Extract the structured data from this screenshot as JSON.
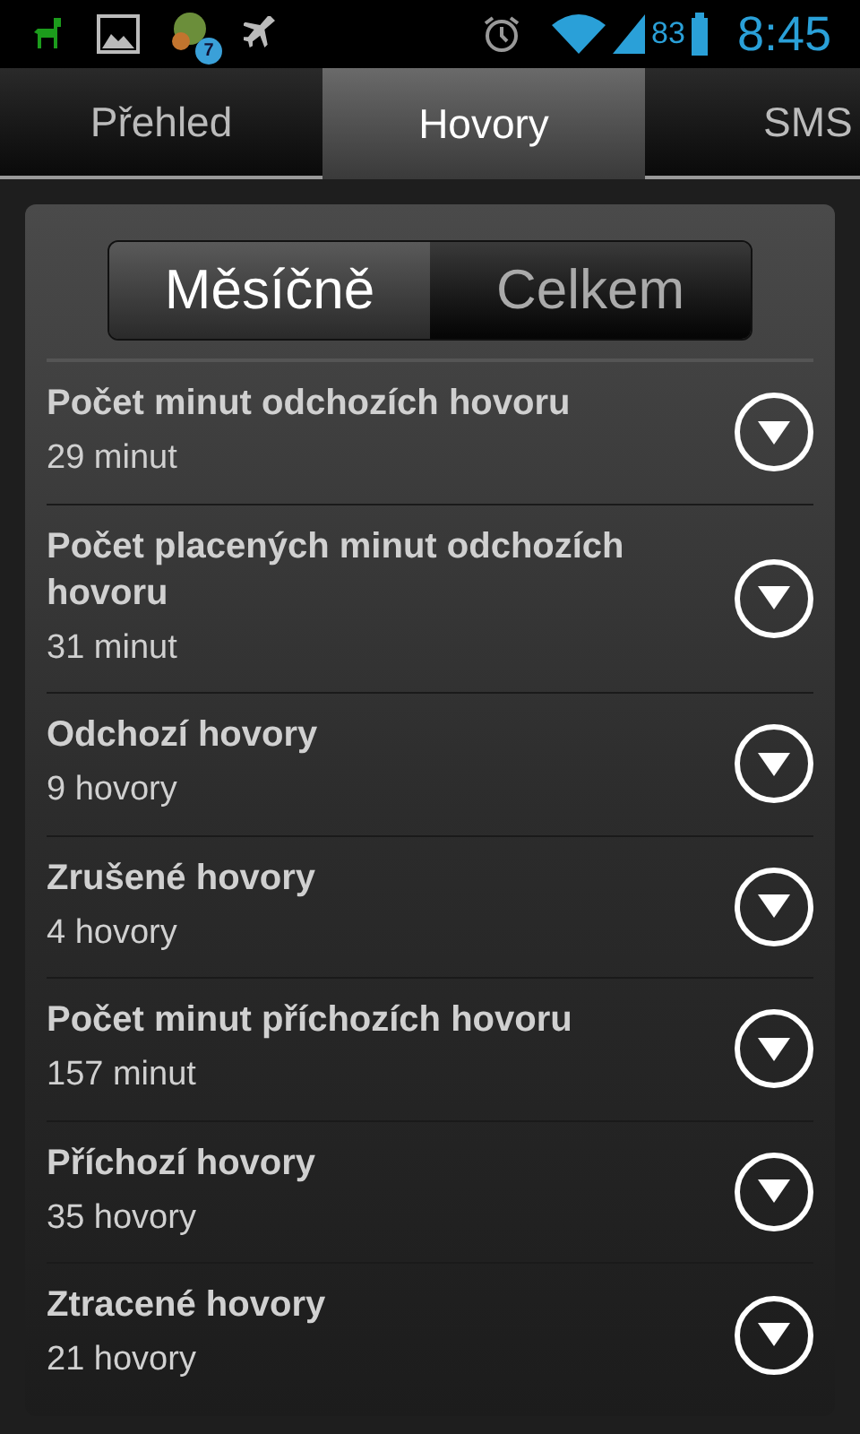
{
  "status_bar": {
    "notification_badge": "7",
    "battery": "83",
    "time": "8:45"
  },
  "tabs": [
    {
      "label": "Přehled",
      "selected": false
    },
    {
      "label": "Hovory",
      "selected": true
    },
    {
      "label": "SMS",
      "selected": false
    }
  ],
  "period_toggle": [
    {
      "label": "Měsíčně",
      "selected": true
    },
    {
      "label": "Celkem",
      "selected": false
    }
  ],
  "stats": [
    {
      "title": "Počet minut odchozích hovoru",
      "value": "29 minut"
    },
    {
      "title": "Počet placených minut odchozích hovoru",
      "value": "31 minut"
    },
    {
      "title": "Odchozí hovory",
      "value": "9 hovory"
    },
    {
      "title": "Zrušené hovory",
      "value": "4 hovory"
    },
    {
      "title": "Počet minut příchozích hovoru",
      "value": "157 minut"
    },
    {
      "title": "Příchozí hovory",
      "value": "35 hovory"
    },
    {
      "title": "Ztracené hovory",
      "value": "21 hovory"
    }
  ]
}
